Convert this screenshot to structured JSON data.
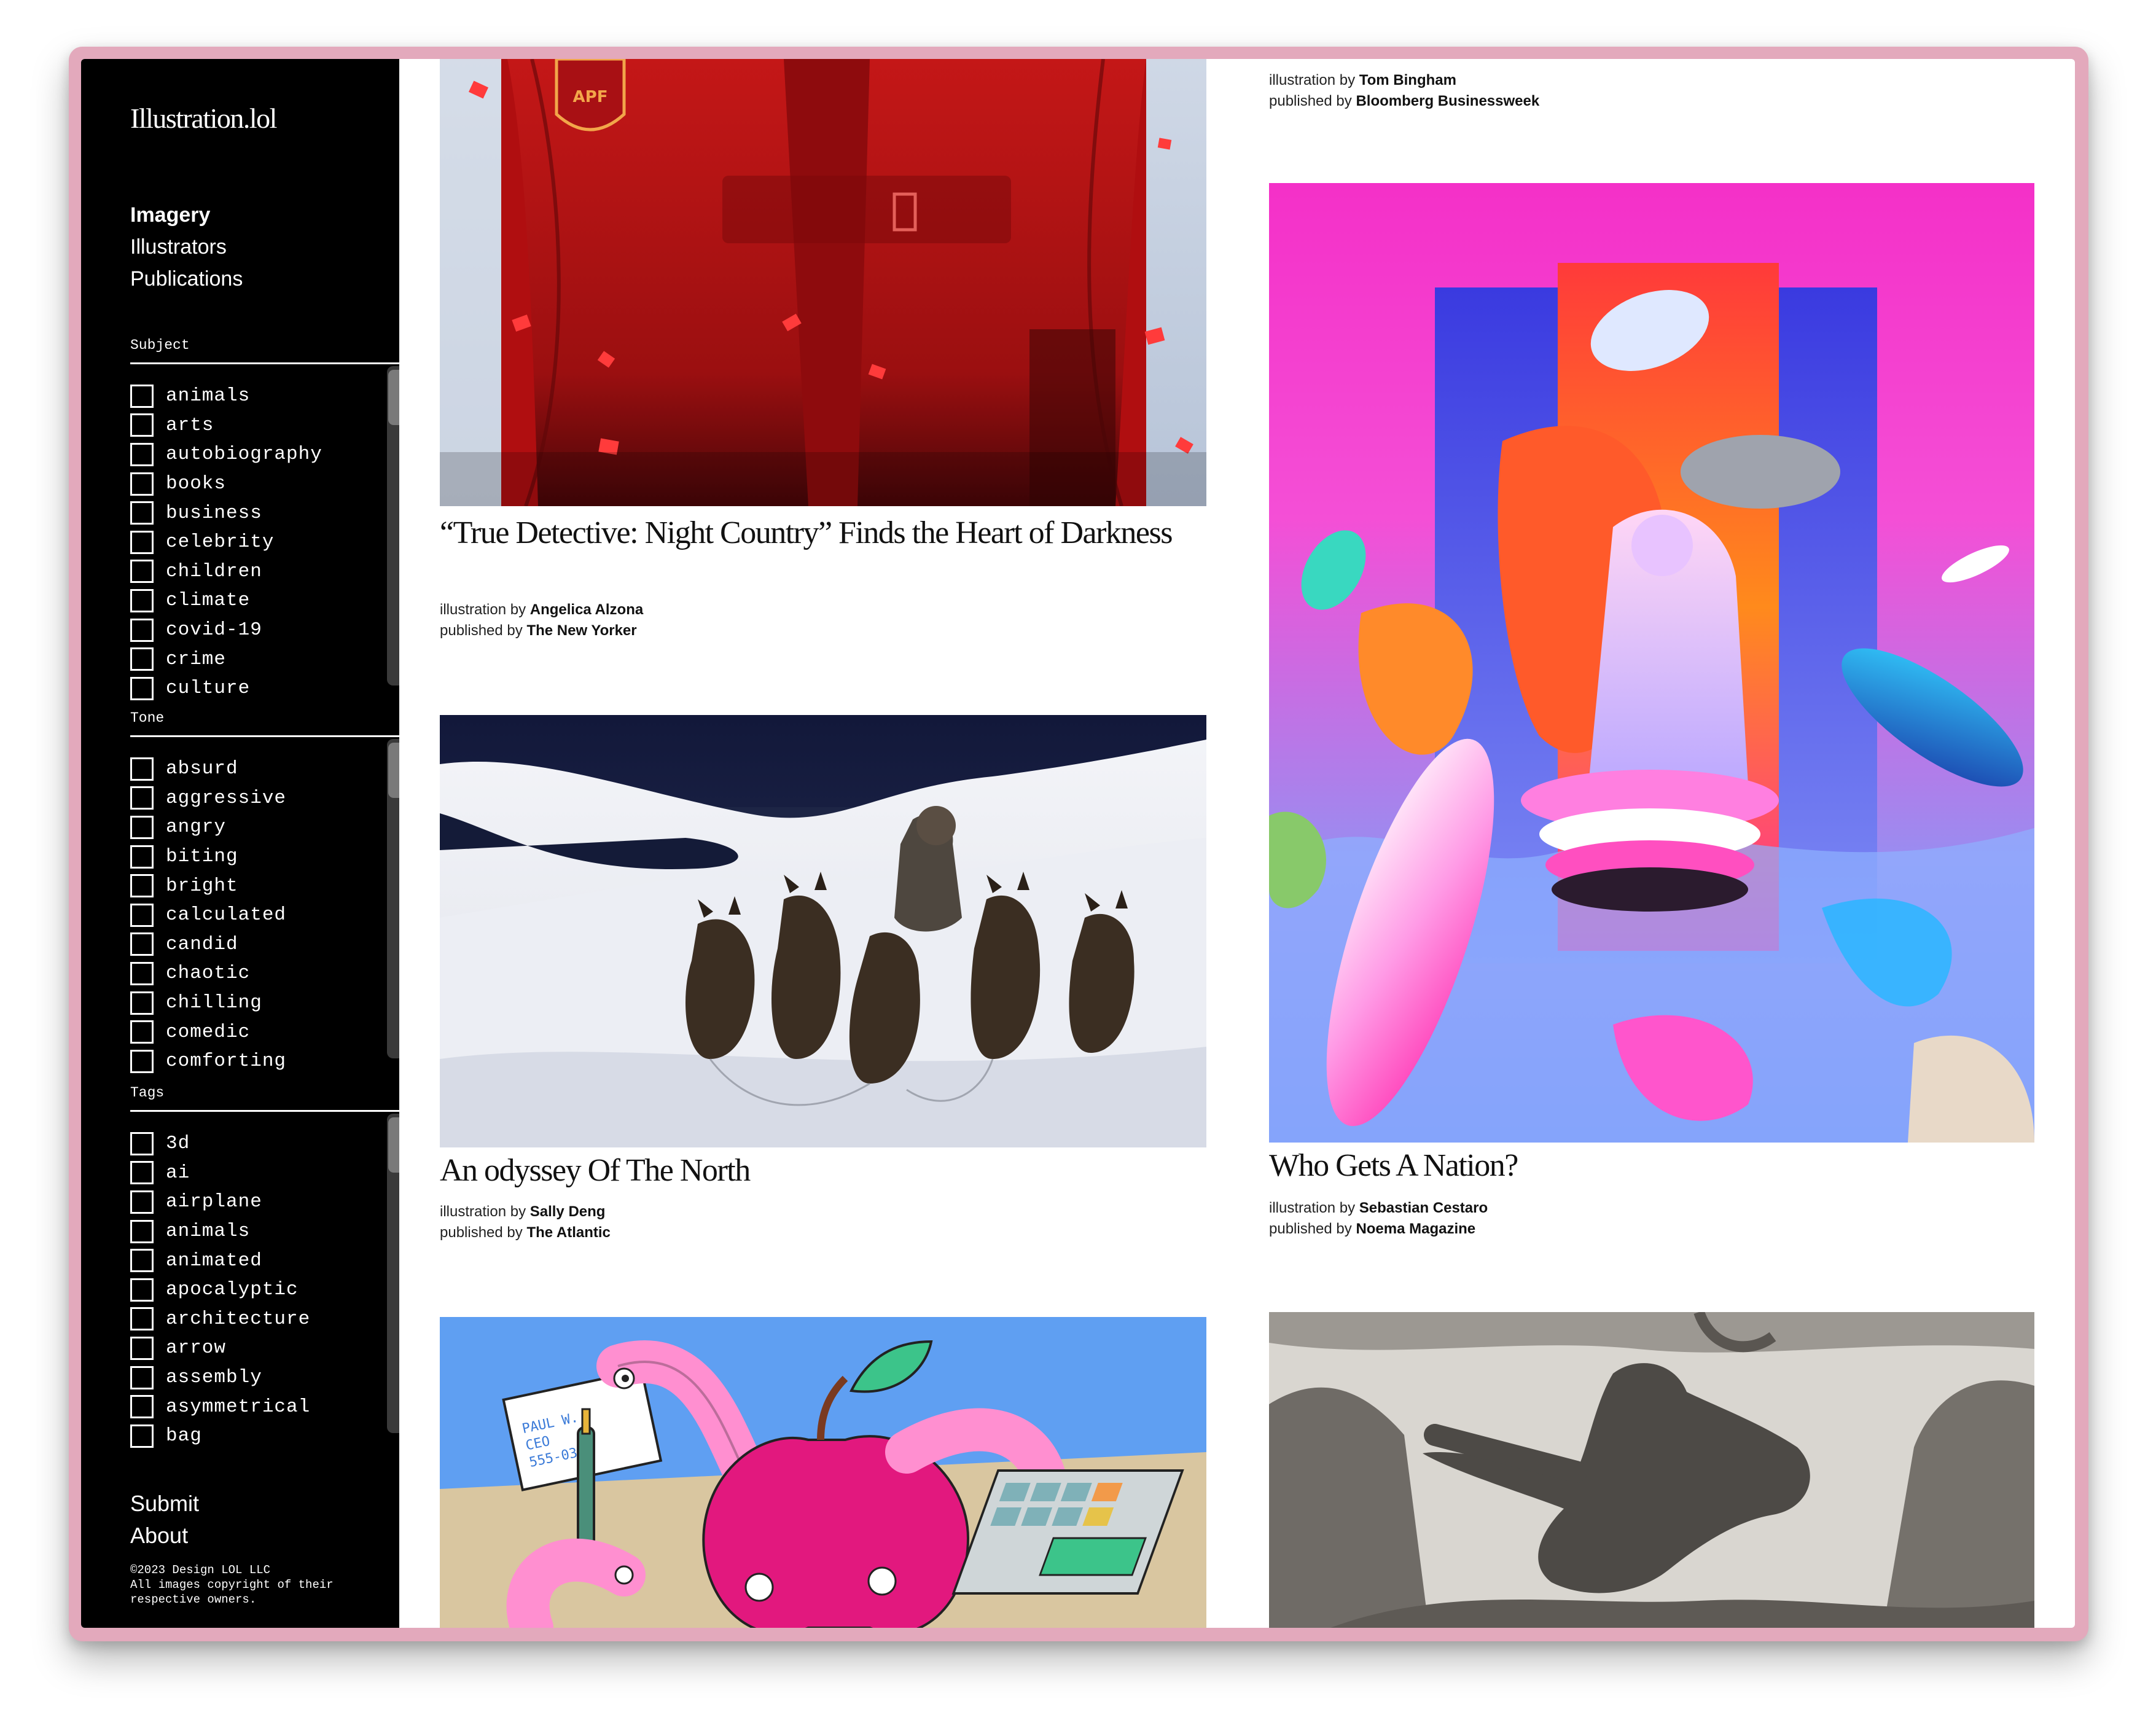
{
  "site": {
    "logo": "Illustration.lol"
  },
  "nav": [
    {
      "label": "Imagery",
      "active": true
    },
    {
      "label": "Illustrators",
      "active": false
    },
    {
      "label": "Publications",
      "active": false
    }
  ],
  "filters": {
    "subject": {
      "title": "Subject",
      "options": [
        "animals",
        "arts",
        "autobiography",
        "books",
        "business",
        "celebrity",
        "children",
        "climate",
        "covid-19",
        "crime",
        "culture"
      ]
    },
    "tone": {
      "title": "Tone",
      "options": [
        "absurd",
        "aggressive",
        "angry",
        "biting",
        "bright",
        "calculated",
        "candid",
        "chaotic",
        "chilling",
        "comedic",
        "comforting"
      ]
    },
    "tags": {
      "title": "Tags",
      "options": [
        "3d",
        "ai",
        "airplane",
        "animals",
        "animated",
        "apocalyptic",
        "architecture",
        "arrow",
        "assembly",
        "asymmetrical",
        "bag"
      ]
    }
  },
  "footer": {
    "submit": "Submit",
    "about": "About",
    "copyright": "©2023 Design LOL LLC\nAll images copyright of their respective owners."
  },
  "labels": {
    "illustration_by": "illustration by",
    "published_by": "published by"
  },
  "cards": {
    "top_right": {
      "illustrator": "Tom Bingham",
      "publication": "Bloomberg Businessweek"
    },
    "true_detective": {
      "title": "“True Detective: Night Country” Finds the Heart of Darkness",
      "illustrator": "Angelica Alzona",
      "publication": "The New Yorker"
    },
    "nation": {
      "title": "Who Gets A Nation?",
      "illustrator": "Sebastian Cestaro",
      "publication": "Noema Magazine"
    },
    "odyssey": {
      "title": "An odyssey Of The North",
      "illustrator": "Sally Deng",
      "publication": "The Atlantic"
    }
  },
  "images": {
    "true_detective": "red illustration of a police officer in snow",
    "nation": "colorful surreal illustration of a figure on floating discs",
    "odyssey": "person with sled dogs in a snowy landscape",
    "apple": "pink apple with worms and a calculator",
    "shadow": "grey shadowy figure pointing"
  },
  "card_text_apple_sign": "PAUL W.\nCEO\n555-0342"
}
